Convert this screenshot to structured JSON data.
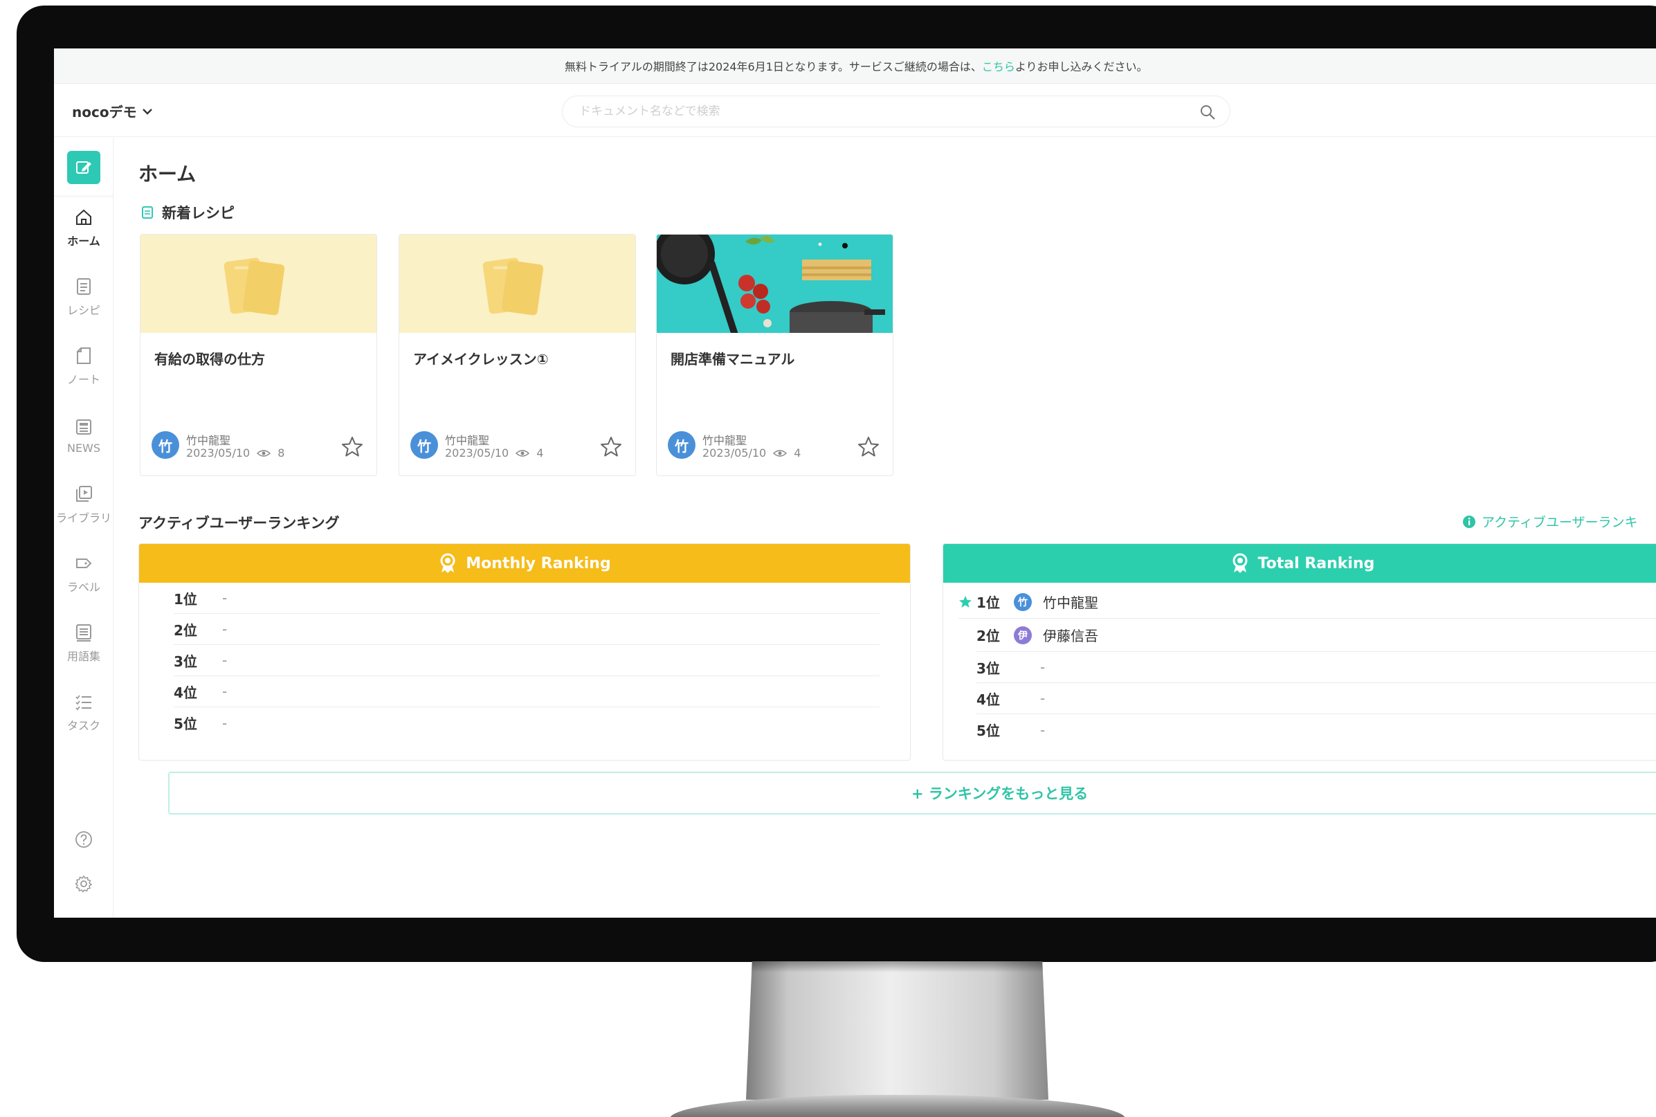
{
  "notice": {
    "text_before": "無料トライアルの期間終了は2024年6月1日となります。サービスご継続の場合は、",
    "link": "こちら",
    "text_after": "よりお申し込みください。"
  },
  "header": {
    "workspace": "nocoデモ",
    "search_placeholder": "ドキュメント名などで検索"
  },
  "sidebar": {
    "items": [
      {
        "label": "ホーム",
        "icon": "home-icon"
      },
      {
        "label": "レシピ",
        "icon": "recipe-icon"
      },
      {
        "label": "ノート",
        "icon": "note-icon"
      },
      {
        "label": "NEWS",
        "icon": "news-icon"
      },
      {
        "label": "ライブラリ",
        "icon": "library-icon"
      },
      {
        "label": "ラベル",
        "icon": "label-icon"
      },
      {
        "label": "用語集",
        "icon": "glossary-icon"
      },
      {
        "label": "タスク",
        "icon": "task-icon"
      }
    ]
  },
  "main": {
    "page_title": "ホーム",
    "new_recipes_title": "新着レシピ",
    "cards": [
      {
        "title": "有給の取得の仕方",
        "avatar": "竹",
        "author": "竹中龍聖",
        "date": "2023/05/10",
        "views": "8"
      },
      {
        "title": "アイメイクレッスン①",
        "avatar": "竹",
        "author": "竹中龍聖",
        "date": "2023/05/10",
        "views": "4"
      },
      {
        "title": "開店準備マニュアル",
        "avatar": "竹",
        "author": "竹中龍聖",
        "date": "2023/05/10",
        "views": "4"
      }
    ],
    "ranking_title": "アクティブユーザーランキング",
    "ranking_info": "アクティブユーザーランキ",
    "monthly": {
      "title": "Monthly Ranking",
      "rows": [
        {
          "pos": "1位",
          "value": "-"
        },
        {
          "pos": "2位",
          "value": "-"
        },
        {
          "pos": "3位",
          "value": "-"
        },
        {
          "pos": "4位",
          "value": "-"
        },
        {
          "pos": "5位",
          "value": "-"
        }
      ]
    },
    "total": {
      "title": "Total Ranking",
      "rows": [
        {
          "pos": "1位",
          "avatar": "竹",
          "name": "竹中龍聖"
        },
        {
          "pos": "2位",
          "avatar": "伊",
          "name": "伊藤信吾"
        },
        {
          "pos": "3位",
          "value": "-"
        },
        {
          "pos": "4位",
          "value": "-"
        },
        {
          "pos": "5位",
          "value": "-"
        }
      ]
    },
    "more_label": "+ ランキングをもっと見る"
  },
  "colors": {
    "accent": "#2ec9b4",
    "monthly_header": "#f6bc1a",
    "total_header": "#2ccfad",
    "avatar_blue": "#4a90d9",
    "avatar_purple": "#8e7bd6"
  }
}
